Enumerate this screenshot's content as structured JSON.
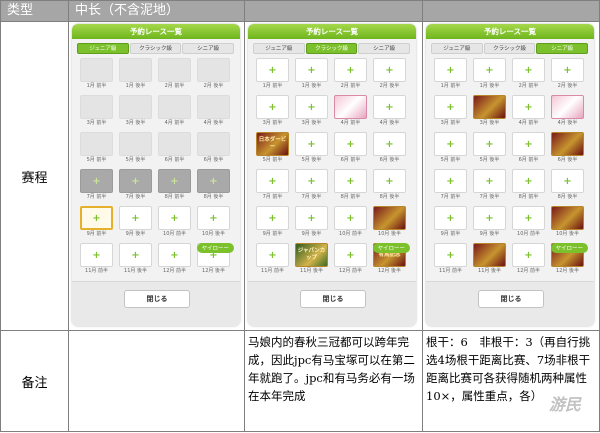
{
  "header": {
    "col_type": "类型",
    "col_value": "中长（不含泥地）"
  },
  "rows": {
    "schedule_label": "赛程",
    "note_label": "备注"
  },
  "panels": [
    {
      "title": "予約レース一覧",
      "tabs": [
        "ジュニア級",
        "クラシック級",
        "シニア級"
      ],
      "active_tab": 0,
      "close_label": "閉じる",
      "badge": "ヤイローー",
      "slots": [
        {
          "label": "1月 前半",
          "state": "empty",
          "text": ""
        },
        {
          "label": "1月 後半",
          "state": "empty",
          "text": ""
        },
        {
          "label": "2月 前半",
          "state": "empty",
          "text": ""
        },
        {
          "label": "2月 後半",
          "state": "empty",
          "text": ""
        },
        {
          "label": "3月 前半",
          "state": "empty",
          "text": ""
        },
        {
          "label": "3月 後半",
          "state": "empty",
          "text": ""
        },
        {
          "label": "4月 前半",
          "state": "empty",
          "text": ""
        },
        {
          "label": "4月 後半",
          "state": "empty",
          "text": ""
        },
        {
          "label": "5月 前半",
          "state": "empty",
          "text": ""
        },
        {
          "label": "5月 後半",
          "state": "empty",
          "text": ""
        },
        {
          "label": "6月 前半",
          "state": "empty",
          "text": ""
        },
        {
          "label": "6月 後半",
          "state": "empty",
          "text": ""
        },
        {
          "label": "7月 前半",
          "state": "dark",
          "text": "+"
        },
        {
          "label": "7月 後半",
          "state": "dark",
          "text": "+"
        },
        {
          "label": "8月 前半",
          "state": "dark",
          "text": "+"
        },
        {
          "label": "8月 後半",
          "state": "dark",
          "text": "+"
        },
        {
          "label": "9月 前半",
          "state": "sel",
          "text": "+"
        },
        {
          "label": "9月 後半",
          "state": "plus",
          "text": "+"
        },
        {
          "label": "10月 前半",
          "state": "plus",
          "text": "+"
        },
        {
          "label": "10月 後半",
          "state": "plus",
          "text": "+"
        },
        {
          "label": "11月 前半",
          "state": "plus",
          "text": "+"
        },
        {
          "label": "11月 後半",
          "state": "plus",
          "text": "+"
        },
        {
          "label": "12月 前半",
          "state": "plus",
          "text": "+"
        },
        {
          "label": "12月 後半",
          "state": "plus",
          "text": "+"
        }
      ]
    },
    {
      "title": "予約レース一覧",
      "tabs": [
        "ジュニア級",
        "クラシック級",
        "シニア級"
      ],
      "active_tab": 1,
      "close_label": "閉じる",
      "badge": "ヤイローー",
      "slots": [
        {
          "label": "1月 前半",
          "state": "plus",
          "text": "+"
        },
        {
          "label": "1月 後半",
          "state": "plus",
          "text": "+"
        },
        {
          "label": "2月 前半",
          "state": "plus",
          "text": "+"
        },
        {
          "label": "2月 後半",
          "state": "plus",
          "text": "+"
        },
        {
          "label": "3月 前半",
          "state": "plus",
          "text": "+"
        },
        {
          "label": "3月 後半",
          "state": "plus",
          "text": "+"
        },
        {
          "label": "4月 前半",
          "state": "race pink",
          "text": ""
        },
        {
          "label": "4月 後半",
          "state": "plus",
          "text": "+"
        },
        {
          "label": "5月 前半",
          "state": "race",
          "text": "日本ダービー"
        },
        {
          "label": "5月 後半",
          "state": "plus",
          "text": "+"
        },
        {
          "label": "6月 前半",
          "state": "plus",
          "text": "+"
        },
        {
          "label": "6月 後半",
          "state": "plus",
          "text": "+"
        },
        {
          "label": "7月 前半",
          "state": "plus",
          "text": "+"
        },
        {
          "label": "7月 後半",
          "state": "plus",
          "text": "+"
        },
        {
          "label": "8月 前半",
          "state": "plus",
          "text": "+"
        },
        {
          "label": "8月 後半",
          "state": "plus",
          "text": "+"
        },
        {
          "label": "9月 前半",
          "state": "plus",
          "text": "+"
        },
        {
          "label": "9月 後半",
          "state": "plus",
          "text": "+"
        },
        {
          "label": "10月 前半",
          "state": "plus",
          "text": "+"
        },
        {
          "label": "10月 後半",
          "state": "race",
          "text": ""
        },
        {
          "label": "11月 前半",
          "state": "plus",
          "text": "+"
        },
        {
          "label": "11月 後半",
          "state": "race green",
          "text": "ジャパンカップ"
        },
        {
          "label": "12月 前半",
          "state": "plus",
          "text": "+"
        },
        {
          "label": "12月 後半",
          "state": "race",
          "text": "有馬記念"
        }
      ]
    },
    {
      "title": "予約レース一覧",
      "tabs": [
        "ジュニア級",
        "クラシック級",
        "シニア級"
      ],
      "active_tab": 2,
      "close_label": "閉じる",
      "badge": "ヤイローー",
      "slots": [
        {
          "label": "1月 前半",
          "state": "plus",
          "text": "+"
        },
        {
          "label": "1月 後半",
          "state": "plus",
          "text": "+"
        },
        {
          "label": "2月 前半",
          "state": "plus",
          "text": "+"
        },
        {
          "label": "2月 後半",
          "state": "plus",
          "text": "+"
        },
        {
          "label": "3月 前半",
          "state": "plus",
          "text": "+"
        },
        {
          "label": "3月 後半",
          "state": "race",
          "text": ""
        },
        {
          "label": "4月 前半",
          "state": "plus",
          "text": "+"
        },
        {
          "label": "4月 後半",
          "state": "race pink",
          "text": ""
        },
        {
          "label": "5月 前半",
          "state": "plus",
          "text": "+"
        },
        {
          "label": "5月 後半",
          "state": "plus",
          "text": "+"
        },
        {
          "label": "6月 前半",
          "state": "plus",
          "text": "+"
        },
        {
          "label": "6月 後半",
          "state": "race",
          "text": ""
        },
        {
          "label": "7月 前半",
          "state": "plus",
          "text": "+"
        },
        {
          "label": "7月 後半",
          "state": "plus",
          "text": "+"
        },
        {
          "label": "8月 前半",
          "state": "plus",
          "text": "+"
        },
        {
          "label": "8月 後半",
          "state": "plus",
          "text": "+"
        },
        {
          "label": "9月 前半",
          "state": "plus",
          "text": "+"
        },
        {
          "label": "9月 後半",
          "state": "plus",
          "text": "+"
        },
        {
          "label": "10月 前半",
          "state": "plus",
          "text": "+"
        },
        {
          "label": "10月 後半",
          "state": "race",
          "text": ""
        },
        {
          "label": "11月 前半",
          "state": "plus",
          "text": "+"
        },
        {
          "label": "11月 後半",
          "state": "race",
          "text": ""
        },
        {
          "label": "12月 前半",
          "state": "plus",
          "text": "+"
        },
        {
          "label": "12月 後半",
          "state": "race",
          "text": ""
        }
      ]
    }
  ],
  "notes": [
    "",
    "马娘内的春秋三冠都可以跨年完成，因此jpc有马宝塚可以在第二年就跑了。jpc和有马务必有一场在本年完成",
    "根干：6　非根干：3（再自行挑选4场根干距离比赛、7场非根干距离比赛可各获得随机两种属性10×，属性重点，各）"
  ],
  "watermark": "游民"
}
